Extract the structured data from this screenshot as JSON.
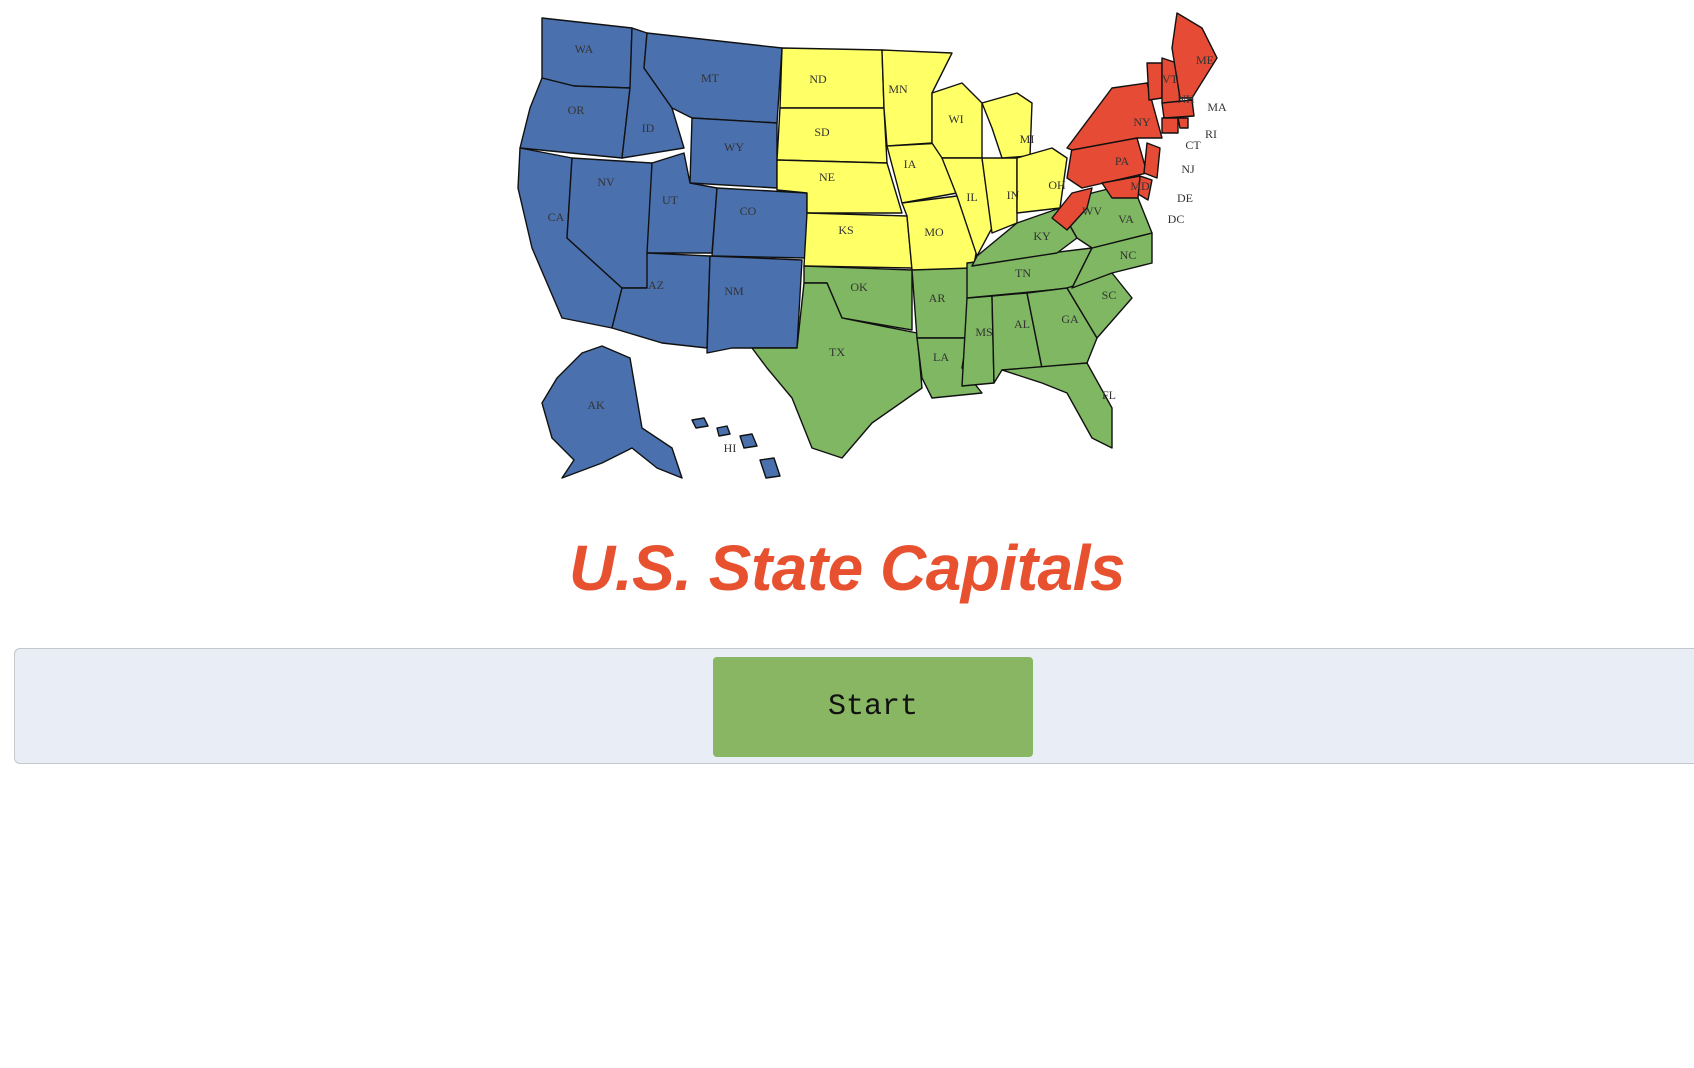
{
  "title": "U.S. State Capitals",
  "start_button": {
    "label": "Start"
  },
  "colors": {
    "title": "#e8512f",
    "button": "#88b662",
    "panel": "#e9edf5",
    "region_west": "#4a70ad",
    "region_midwest": "#ffff66",
    "region_south": "#7fb762",
    "region_northeast": "#e64b35"
  },
  "map": {
    "labels": [
      "WA",
      "OR",
      "CA",
      "ID",
      "NV",
      "MT",
      "WY",
      "UT",
      "CO",
      "AZ",
      "NM",
      "AK",
      "HI",
      "ND",
      "SD",
      "NE",
      "KS",
      "MN",
      "IA",
      "MO",
      "WI",
      "IL",
      "IN",
      "MI",
      "OH",
      "OK",
      "TX",
      "AR",
      "LA",
      "MS",
      "AL",
      "TN",
      "KY",
      "GA",
      "FL",
      "SC",
      "NC",
      "VA",
      "WV",
      "PA",
      "NY",
      "VT",
      "NH",
      "ME",
      "MA",
      "RI",
      "CT",
      "NJ",
      "DE",
      "DC",
      "MD"
    ]
  }
}
